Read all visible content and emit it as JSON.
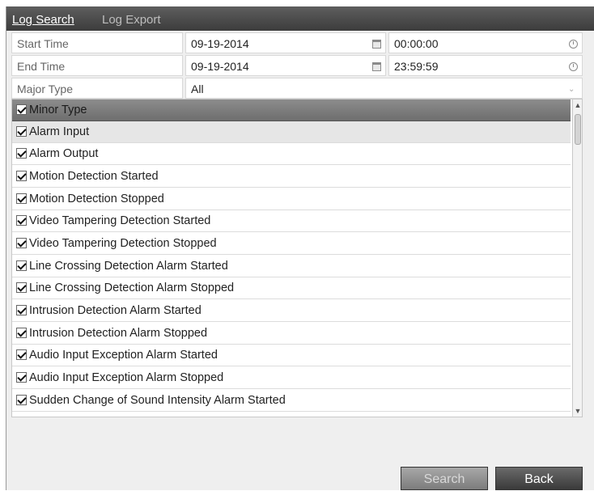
{
  "tabs": {
    "active": "Log Search",
    "inactive": "Log Export"
  },
  "form": {
    "start_label": "Start Time",
    "start_date": "09-19-2014",
    "start_time": "00:00:00",
    "end_label": "End Time",
    "end_date": "09-19-2014",
    "end_time": "23:59:59",
    "major_label": "Major Type",
    "major_value": "All"
  },
  "list": {
    "header": "Minor Type",
    "items": [
      "Alarm Input",
      "Alarm Output",
      "Motion Detection Started",
      "Motion Detection Stopped",
      "Video Tampering Detection Started",
      "Video Tampering Detection Stopped",
      "Line Crossing Detection Alarm Started",
      "Line Crossing Detection Alarm Stopped",
      "Intrusion Detection Alarm Started",
      "Intrusion Detection Alarm Stopped",
      "Audio Input Exception Alarm Started",
      "Audio Input Exception Alarm Stopped",
      "Sudden Change of Sound Intensity Alarm Started"
    ]
  },
  "buttons": {
    "search": "Search",
    "back": "Back"
  }
}
